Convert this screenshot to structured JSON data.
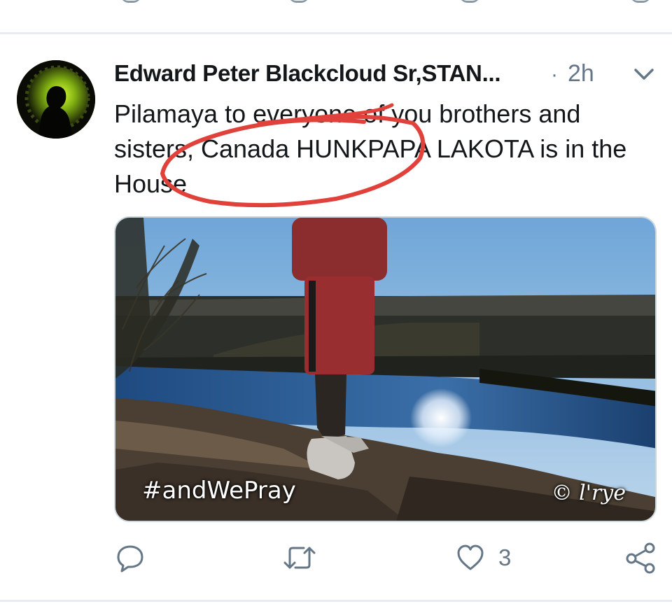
{
  "tweet": {
    "author_name": "Edward Peter Blackcloud Sr,STAN...",
    "separator": "·",
    "time": "2h",
    "text_line_1": "Pilamaya to everyone of you brothers and",
    "text_line_2": "sisters, Canada HUNKPAPA LAKOTA is in the",
    "text_line_3": "House",
    "media": {
      "hashtag_overlay": "#andWePray",
      "watermark": "© l'rye"
    },
    "actions": {
      "like_count": "3"
    }
  },
  "colors": {
    "text": "#14171a",
    "muted": "#657786",
    "icon": "#657786",
    "divider": "#e6ecf0",
    "annotation_red": "#e0413a"
  },
  "icons": [
    "chevron-down-icon",
    "reply-icon",
    "retweet-icon",
    "heart-icon",
    "share-icon"
  ]
}
